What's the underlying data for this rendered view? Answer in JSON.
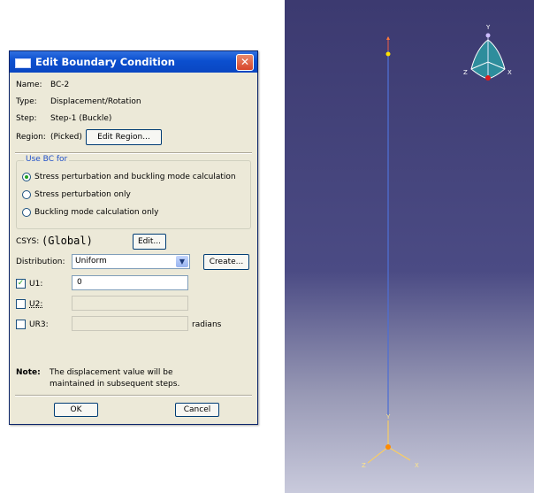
{
  "dialog": {
    "title": "Edit Boundary Condition",
    "name_label": "Name:",
    "name_value": "BC-2",
    "type_label": "Type:",
    "type_value": "Displacement/Rotation",
    "step_label": "Step:",
    "step_value": "Step-1 (Buckle)",
    "region_label": "Region:",
    "region_value": "(Picked)",
    "edit_region_button": "Edit Region...",
    "use_bc_group": {
      "title": "Use BC for",
      "options": [
        {
          "label": "Stress perturbation and buckling mode calculation",
          "selected": true
        },
        {
          "label": "Stress perturbation only",
          "selected": false
        },
        {
          "label": "Buckling mode calculation only",
          "selected": false
        }
      ]
    },
    "csys_label": "CSYS:",
    "csys_value": "(Global)",
    "csys_edit_button": "Edit...",
    "distribution_label": "Distribution:",
    "distribution_value": "Uniform",
    "create_button": "Create...",
    "dofs": [
      {
        "label": "U1:",
        "checked": true,
        "value": "0"
      },
      {
        "label": "U2:",
        "checked": false,
        "value": ""
      },
      {
        "label": "UR3:",
        "checked": false,
        "value": "",
        "unit": "radians"
      }
    ],
    "note_label": "Note:",
    "note_line1": "The displacement value will be",
    "note_line2": "maintained in subsequent steps.",
    "ok_button": "OK",
    "cancel_button": "Cancel"
  },
  "viewport": {
    "triad_axes": {
      "y": "Y",
      "z": "Z",
      "x": "X"
    },
    "bottom_axes": {
      "y": "Y",
      "z": "Z",
      "x": "X"
    },
    "colors": {
      "beam": "#4f6fd2",
      "axis": "#ffcf5a",
      "triad": "#49a9b8",
      "accent_red": "#e01b1b"
    }
  }
}
